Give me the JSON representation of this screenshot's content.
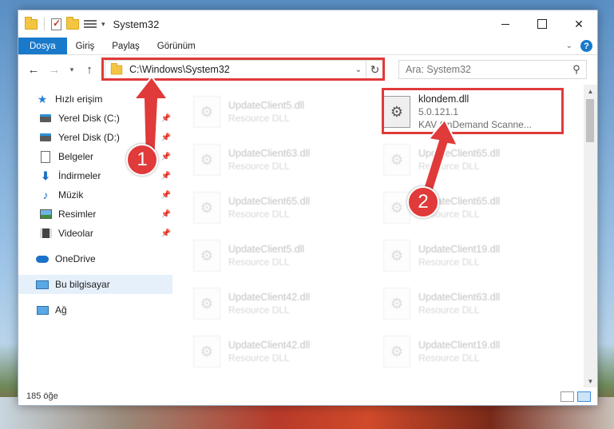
{
  "window": {
    "title": "System32",
    "controls": {
      "minimize": "",
      "maximize": "",
      "close": "✕"
    }
  },
  "ribbon": {
    "tabs": [
      {
        "label": "Dosya",
        "active": true
      },
      {
        "label": "Giriş"
      },
      {
        "label": "Paylaş"
      },
      {
        "label": "Görünüm"
      }
    ]
  },
  "nav": {
    "address_path": "C:\\Windows\\System32",
    "search_placeholder": "Ara: System32"
  },
  "sidebar": {
    "quick_access": "Hızlı erişim",
    "items": [
      {
        "label": "Yerel Disk (C:)",
        "icon": "drive-icon"
      },
      {
        "label": "Yerel Disk (D:)",
        "icon": "drive-icon"
      },
      {
        "label": "Belgeler",
        "icon": "documents-icon"
      },
      {
        "label": "İndirmeler",
        "icon": "downloads-icon"
      },
      {
        "label": "Müzik",
        "icon": "music-icon"
      },
      {
        "label": "Resimler",
        "icon": "pictures-icon"
      },
      {
        "label": "Videolar",
        "icon": "videos-icon"
      }
    ],
    "onedrive": "OneDrive",
    "this_pc": "Bu bilgisayar",
    "network": "Ağ"
  },
  "files": {
    "left_column": [
      {
        "name": "UpdateClient5.dll",
        "desc": "Resource DLL"
      },
      {
        "name": "UpdateClient63.dll",
        "desc": "Resource DLL"
      },
      {
        "name": "UpdateClient65.dll",
        "desc": "Resource DLL"
      },
      {
        "name": "UpdateClient5.dll",
        "desc": "Resource DLL"
      },
      {
        "name": "UpdateClient42.dll",
        "desc": "Resource DLL"
      },
      {
        "name": "UpdateClient42.dll",
        "desc": "Resource DLL"
      }
    ],
    "highlighted": {
      "name": "klondem.dll",
      "version": "5.0.121.1",
      "desc": "KAV OnDemand Scanne..."
    },
    "right_column": [
      {
        "name": "UpdateClient65.dll",
        "desc": "Resource DLL"
      },
      {
        "name": "UpdateClient65.dll",
        "desc": "Resource DLL"
      },
      {
        "name": "UpdateClient19.dll",
        "desc": "Resource DLL"
      },
      {
        "name": "UpdateClient63.dll",
        "desc": "Resource DLL"
      },
      {
        "name": "UpdateClient19.dll",
        "desc": "Resource DLL"
      }
    ]
  },
  "status": {
    "item_count": "185 öğe"
  },
  "annotations": {
    "step1": "1",
    "step2": "2",
    "color": "#e03a3a"
  }
}
